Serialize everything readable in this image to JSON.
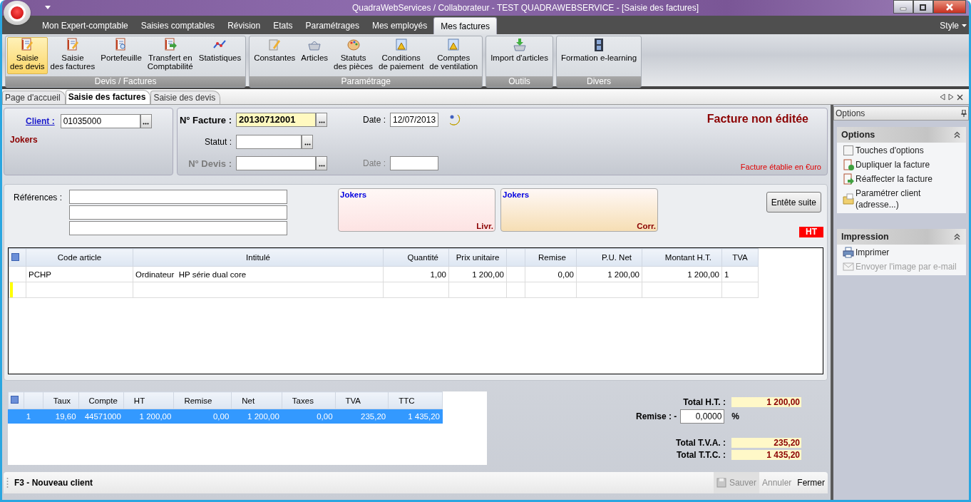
{
  "window": {
    "title": "QuadraWebServices / Collaborateur - TEST QUADRAWEBSERVICE - [Saisie des factures]"
  },
  "menu_tabs": [
    {
      "label": "Mon Expert-comptable",
      "selected": false
    },
    {
      "label": "Saisies comptables",
      "selected": false
    },
    {
      "label": "Révision",
      "selected": false
    },
    {
      "label": "Etats",
      "selected": false
    },
    {
      "label": "Paramétrages",
      "selected": false
    },
    {
      "label": "Mes employés",
      "selected": false
    },
    {
      "label": "Mes factures",
      "selected": true
    }
  ],
  "style_menu": "Style",
  "ribbon": {
    "groups": [
      {
        "label": "Devis / Factures",
        "buttons": [
          {
            "label": "Saisie\ndes devis",
            "kind": "notebook",
            "selected": true
          },
          {
            "label": "Saisie\ndes factures",
            "kind": "notebook",
            "selected": false
          },
          {
            "label": "Portefeuille",
            "kind": "notebook-search",
            "selected": false
          },
          {
            "label": "Transfert en\nComptabilité",
            "kind": "notebook-arrow",
            "selected": false
          },
          {
            "label": "Statistiques",
            "kind": "chart",
            "selected": false
          }
        ]
      },
      {
        "label": "Paramétrage",
        "buttons": [
          {
            "label": "Constantes",
            "kind": "pencil",
            "selected": false
          },
          {
            "label": "Articles",
            "kind": "basket",
            "selected": false
          },
          {
            "label": "Statuts\ndes pièces",
            "kind": "palette",
            "selected": false
          },
          {
            "label": "Conditions\nde paiement",
            "kind": "warning",
            "selected": false
          },
          {
            "label": "Comptes\nde ventilation",
            "kind": "warning",
            "selected": false
          }
        ]
      },
      {
        "label": "Outils",
        "buttons": [
          {
            "label": "Import d'articles",
            "kind": "basket-arrow",
            "selected": false
          }
        ]
      },
      {
        "label": "Divers",
        "buttons": [
          {
            "label": "Formation e-learning",
            "kind": "film",
            "selected": false
          }
        ]
      }
    ]
  },
  "doc_tabs": [
    {
      "label": "Page d'accueil",
      "selected": false
    },
    {
      "label": "Saisie des factures",
      "selected": true
    },
    {
      "label": "Saisie des devis",
      "selected": false
    }
  ],
  "client": {
    "label": "Client :",
    "value": "01035000",
    "name": "Jokers"
  },
  "invoice": {
    "number_label": "N° Facture :",
    "number": "20130712001",
    "date_label": "Date :",
    "date": "12/07/2013",
    "status_label": "Statut :",
    "quote": {
      "label": "N° Devis :",
      "date_label": "Date :",
      "disabled": true
    },
    "state": "Facture non éditée",
    "currency_note": "Facture établie en €uro"
  },
  "references": {
    "label": "Références :"
  },
  "addresses": [
    {
      "name": "Jokers",
      "tag": "Livr.",
      "color": "#fde3e3"
    },
    {
      "name": "Jokers",
      "tag": "Corr.",
      "color": "#f6deb4"
    }
  ],
  "header_more_button": "Entête suite",
  "price_mode": "HT",
  "lines_table": {
    "columns": [
      {
        "label": "Code article"
      },
      {
        "label": "Intitulé"
      },
      {
        "label": "Quantité"
      },
      {
        "label": "Prix unitaire"
      },
      {},
      {
        "label": "Remise"
      },
      {
        "label": "P.U. Net"
      },
      {
        "label": "Montant H.T."
      },
      {
        "label": "TVA"
      }
    ],
    "rows": [
      {
        "current": false,
        "cells": [
          "PCHP",
          "Ordinateur  HP série dual core",
          "1,00",
          "1 200,00",
          null,
          "0,00",
          "1 200,00",
          "1 200,00",
          "1"
        ]
      },
      {
        "current": true,
        "cells": [
          null,
          null,
          null,
          null,
          null,
          null,
          null,
          null,
          null
        ]
      }
    ]
  },
  "vat_table": {
    "columns": [
      {},
      {
        "label": "Taux"
      },
      {
        "label": "Compte"
      },
      {
        "label": "HT"
      },
      {
        "label": "Remise"
      },
      {
        "label": "Net"
      },
      {
        "label": "Taxes"
      },
      {
        "label": "TVA"
      },
      {
        "label": "TTC"
      }
    ],
    "rows": [
      {
        "selected": true,
        "cells": [
          "1",
          "19,60",
          "44571000",
          "1 200,00",
          "0,00",
          "1 200,00",
          "0,00",
          "235,20",
          "1 435,20"
        ]
      }
    ]
  },
  "totals": [
    {
      "kind": "total",
      "label": "Total H.T. :",
      "value": "1 200,00"
    },
    {
      "kind": "input",
      "label": "Remise : -",
      "value": "0,0000",
      "unit": "%"
    },
    {
      "kind": "total",
      "label": "Total T.V.A. :",
      "value": "235,20"
    },
    {
      "kind": "total",
      "label": "Total T.T.C. :",
      "value": "1 435,20"
    }
  ],
  "footer": {
    "hint": "F3 - Nouveau client",
    "actions": [
      {
        "label": "Sauver",
        "kind": "save",
        "disabled": true
      },
      {
        "label": "Annuler",
        "kind": "plain",
        "disabled": true
      },
      {
        "label": "Fermer",
        "kind": "plain",
        "disabled": false
      }
    ]
  },
  "options_pane": {
    "title": "Options",
    "sections": [
      {
        "title": "Options",
        "items": [
          {
            "label": "Touches d'options",
            "kind": "box",
            "disabled": false
          },
          {
            "label": "Dupliquer la facture",
            "kind": "doc-plus",
            "disabled": false
          },
          {
            "label": "Réaffecter la facture",
            "kind": "doc-arrow",
            "disabled": false
          },
          {
            "label": "Paramétrer client\n(adresse...)",
            "kind": "folder",
            "disabled": false
          }
        ]
      },
      {
        "title": "Impression",
        "items": [
          {
            "label": "Imprimer",
            "kind": "printer",
            "disabled": false
          },
          {
            "label": "Envoyer l'image par e-mail",
            "kind": "mail",
            "disabled": true
          }
        ]
      }
    ]
  }
}
